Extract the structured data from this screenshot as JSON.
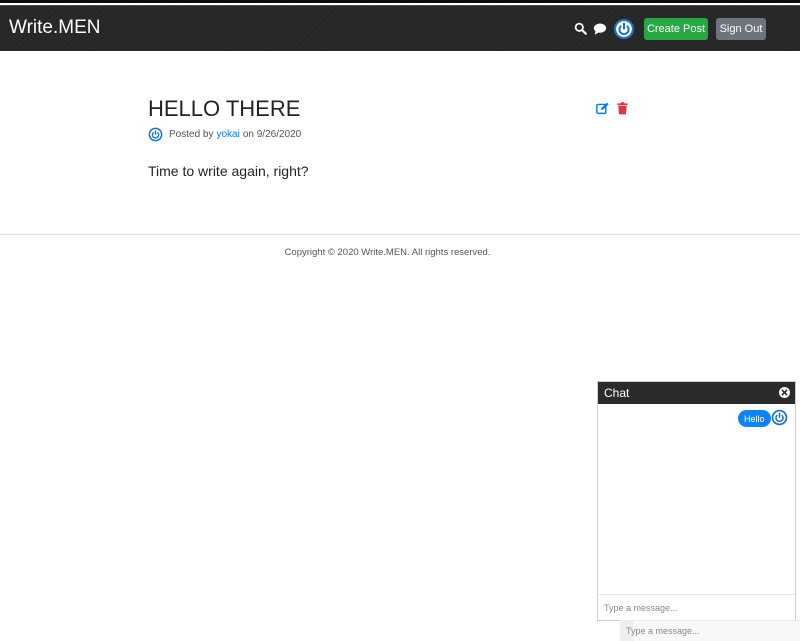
{
  "navbar": {
    "brand": "Write.MEN",
    "icons": [
      "search-icon",
      "chat-bubble-icon",
      "power-avatar-icon"
    ],
    "create_post_label": "Create Post",
    "sign_out_label": "Sign Out"
  },
  "post": {
    "title": "HELLO THERE",
    "posted_by_label": "Posted by",
    "author": "yokai",
    "date_prefix": "on",
    "date": "9/26/2020",
    "body": "Time to write again, right?",
    "actions": [
      "edit-icon",
      "trash-icon"
    ]
  },
  "footer": {
    "copyright": "Copyright © 2020 Write.MEN. All rights reserved."
  },
  "chat": {
    "title": "Chat",
    "messages": [
      {
        "text": "Hello"
      }
    ],
    "input_placeholder": "Type a message...",
    "ghost_input_placeholder": "Type a message..."
  },
  "colors": {
    "navbar_bg": "#2a2a2a",
    "create_button": "#28a745",
    "sign_out_button": "#6c757d",
    "link": "#007bff",
    "chat_bubble": "#0d83fd",
    "avatar": "#1a73c9",
    "delete": "#dc3545"
  }
}
